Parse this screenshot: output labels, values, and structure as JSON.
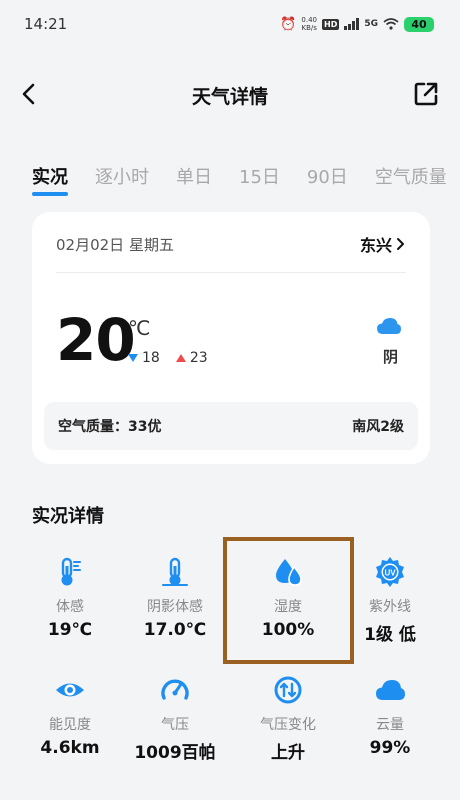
{
  "status_bar": {
    "time": "14:21",
    "net_speed_value": "0.40",
    "net_speed_unit": "KB/s",
    "hd_label": "HD",
    "network_label": "5G",
    "battery": "40"
  },
  "header": {
    "title": "天气详情"
  },
  "tabs": [
    {
      "label": "实况",
      "active": true
    },
    {
      "label": "逐小时"
    },
    {
      "label": "单日"
    },
    {
      "label": "15日"
    },
    {
      "label": "90日"
    },
    {
      "label": "空气质量"
    }
  ],
  "summary": {
    "date": "02月02日 星期五",
    "location": "东兴",
    "temperature": "20",
    "unit": "℃",
    "low": "18",
    "high": "23",
    "condition": "阴",
    "air_quality": "空气质量：33优",
    "wind": "南风2级"
  },
  "details": {
    "title": "实况详情",
    "items": [
      {
        "label": "体感",
        "value": "19℃",
        "icon": "thermometer-icon"
      },
      {
        "label": "阴影体感",
        "value": "17.0℃",
        "icon": "thermometer-shade-icon"
      },
      {
        "label": "湿度",
        "value": "100%",
        "icon": "humidity-drop-icon"
      },
      {
        "label": "紫外线",
        "value": "1级 低",
        "icon": "uv-icon"
      },
      {
        "label": "能见度",
        "value": "4.6km",
        "icon": "eye-icon"
      },
      {
        "label": "气压",
        "value": "1009百帕",
        "icon": "gauge-icon"
      },
      {
        "label": "气压变化",
        "value": "上升",
        "icon": "pressure-change-icon"
      },
      {
        "label": "云量",
        "value": "99%",
        "icon": "cloud-icon"
      }
    ]
  },
  "colors": {
    "accent": "#1f8ef1",
    "highlight": "#996022",
    "low_temp": "#1f8ef1",
    "high_temp": "#f04a4a"
  }
}
